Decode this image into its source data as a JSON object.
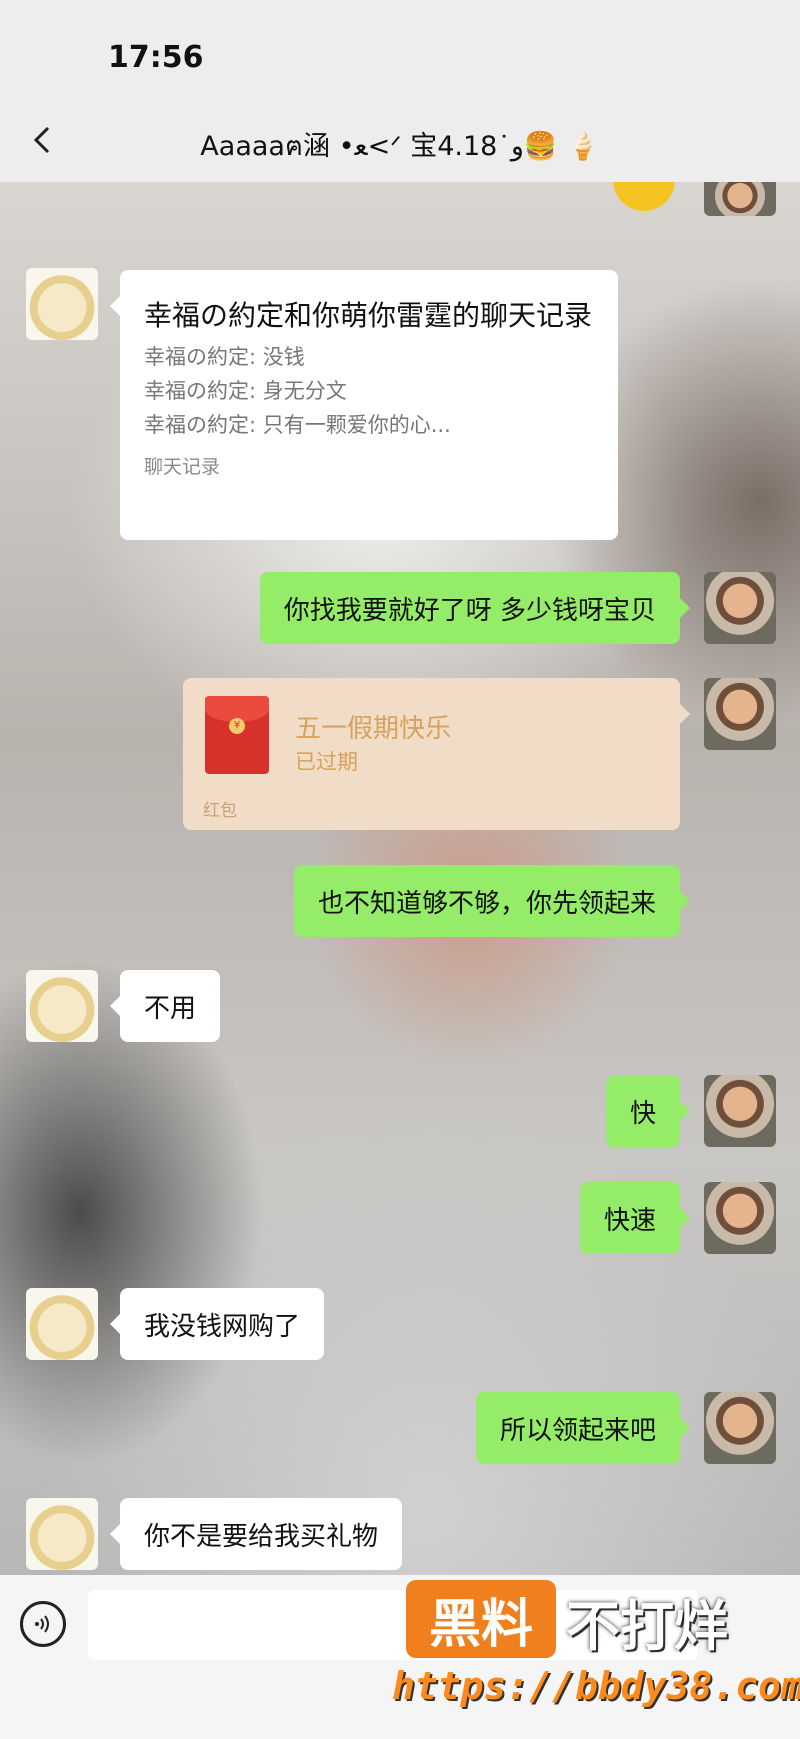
{
  "status_bar": {
    "time": "17:56"
  },
  "header": {
    "title": "Aaaaaฅ涵 •ﻌ<ᐟ 宝ﻭ˙4.18🍔 🍦"
  },
  "chat_record": {
    "title": "幸福の約定和你萌你雷霆的聊天记录",
    "lines": [
      "幸福の約定: 没钱",
      "幸福の約定: 身无分文",
      "幸福の約定: 只有一颗爱你的心..."
    ],
    "footer": "聊天记录"
  },
  "messages": [
    {
      "side": "me",
      "text": "你找我要就好了呀 多少钱呀宝贝"
    },
    {
      "side": "me",
      "text": "也不知道够不够，你先领起来"
    },
    {
      "side": "her",
      "text": "不用"
    },
    {
      "side": "me",
      "text": "快"
    },
    {
      "side": "me",
      "text": "快速"
    },
    {
      "side": "her",
      "text": "我没钱网购了"
    },
    {
      "side": "me",
      "text": "所以领起来吧"
    },
    {
      "side": "her",
      "text": "你不是要给我买礼物"
    }
  ],
  "red_packet": {
    "title": "五一假期快乐",
    "status": "已过期",
    "footer": "红包",
    "coin_label": "¥"
  },
  "watermark": {
    "badge": "黑料",
    "text": "不打烊",
    "url": "https://bbdy38.com"
  }
}
